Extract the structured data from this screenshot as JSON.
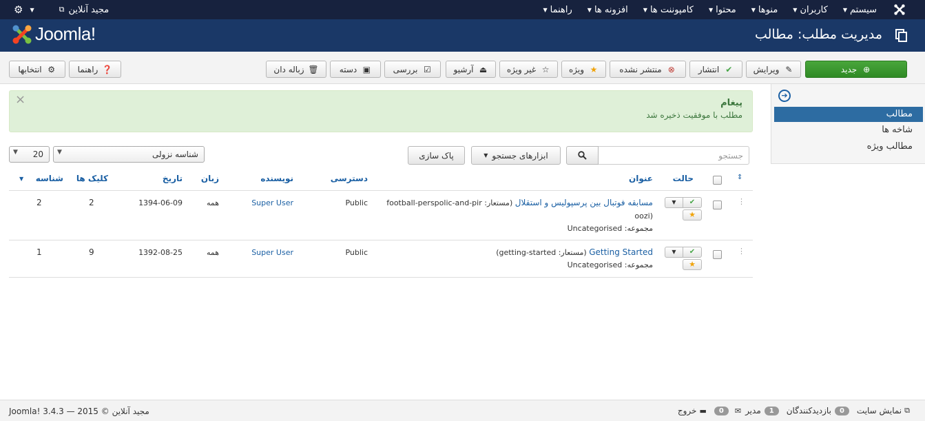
{
  "navbar": {
    "menu": [
      "سیستم",
      "کاربران",
      "منوها",
      "محتوا",
      "کامپوننت ها",
      "افزونه ها",
      "راهنما"
    ],
    "user": "مجید آنلاین"
  },
  "header": {
    "logo_text": "Joomla!",
    "title": "مدیریت مطلب: مطالب"
  },
  "toolbar": {
    "new": "جدید",
    "edit": "ویرایش",
    "publish": "انتشار",
    "unpublish": "منتشر نشده",
    "feature": "ویژه",
    "unfeature": "غیر ویژه",
    "archive": "آرشیو",
    "checkin": "بررسی",
    "batch": "دسته",
    "trash": "زباله دان",
    "help": "راهنما",
    "options": "انتخابها"
  },
  "sidebar": {
    "items": [
      "مطالب",
      "شاخه ها",
      "مطالب ویژه"
    ],
    "active_index": 0
  },
  "alert": {
    "heading": "پیغام",
    "message": "مطلب با موفقیت ذخیره شد"
  },
  "filters": {
    "search_placeholder": "جستجو",
    "search_tools": "ابزارهای جستجو",
    "clear": "پاک سازی",
    "ordering": "شناسه نزولی",
    "limit": "20"
  },
  "table": {
    "headers": {
      "status": "حالت",
      "title": "عنوان",
      "access": "دسترسی",
      "author": "نویسنده",
      "language": "زبان",
      "date": "تاریخ",
      "hits": "کلیک ها",
      "id": "شناسه"
    },
    "rows": [
      {
        "title": "مسابقه فوتبال بین پرسپولیس و استقلال",
        "alias_line1": "(مستعار: football-perspolic-and-pir",
        "alias_line2": "oozi)",
        "category": "مجموعه: Uncategorised",
        "access": "Public",
        "author": "Super User",
        "language": "همه",
        "date": "1394-06-09",
        "hits": "2",
        "id": "2"
      },
      {
        "title": "Getting Started",
        "alias_line1": "(مستعار: getting-started)",
        "alias_line2": "",
        "category": "مجموعه: Uncategorised",
        "access": "Public",
        "author": "Super User",
        "language": "همه",
        "date": "1392-08-25",
        "hits": "9",
        "id": "1"
      }
    ]
  },
  "footer": {
    "view_site": "نمایش سایت",
    "visitors_count": "0",
    "visitors_label": "بازدیدکنندگان",
    "admins_count": "1",
    "admins_label": "مدیر",
    "messages_count": "0",
    "logout": "خروج",
    "copyright": "Joomla! 3.4.3 — مجید آنلاین © 2015"
  }
}
